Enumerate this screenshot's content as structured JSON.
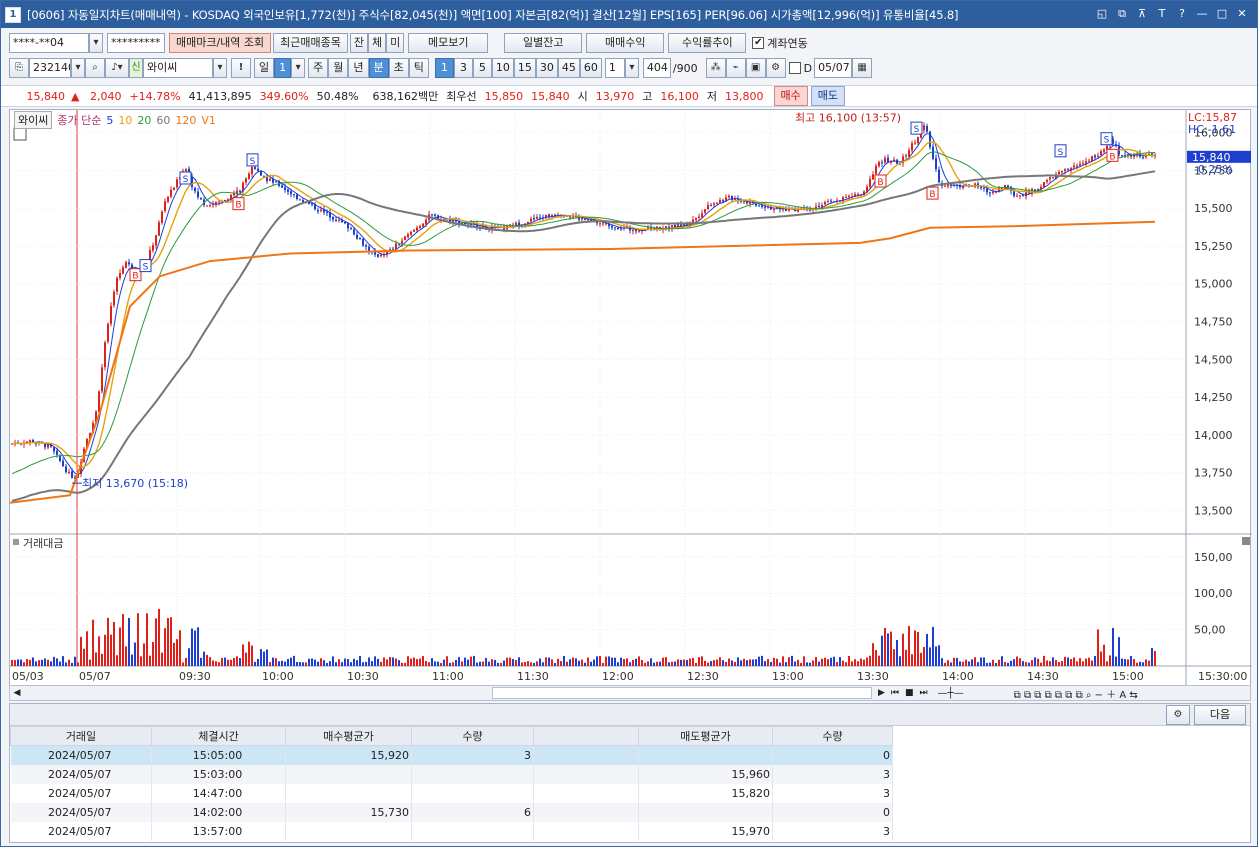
{
  "window": {
    "number": "1",
    "title": "[0606] 자동일지차트(매매내역) - KOSDAQ 외국인보유[1,772(천)] 주식수[82,045(천)] 액면[100] 자본금[82(억)] 결산[12월] EPS[165] PER[96.06] 시가총액[12,996(억)] 유통비율[45.8]",
    "controls": [
      "◱",
      "⧉",
      "⊼",
      "T",
      "?",
      "—",
      "□",
      "✕"
    ]
  },
  "row1": {
    "account": "****-**04",
    "password": "*********",
    "btn_mark": "매매마크/내역 조회",
    "btn_recent": "최근매매종목",
    "btn_jan": "잔",
    "btn_che": "체",
    "btn_mi": "미",
    "btn_memo": "메모보기",
    "btn_daily": "일별잔고",
    "btn_profit": "매매수익",
    "btn_trend": "수익률추이",
    "link_label": "계좌연동",
    "link_checked": "✔"
  },
  "row2": {
    "code": "232140",
    "new_badge": "신",
    "stock_name": "와이씨",
    "warn": "!",
    "periods": [
      "일",
      "1",
      "주",
      "월",
      "년",
      "분",
      "초",
      "틱"
    ],
    "minutes": [
      "1",
      "3",
      "5",
      "10",
      "15",
      "30",
      "45",
      "60"
    ],
    "step": "1",
    "count": "404",
    "count_total": "/900",
    "d_label": "D",
    "date": "05/07",
    "cal_icon": "▦"
  },
  "quote": {
    "price": "15,840",
    "arrow": "▲",
    "change": "2,040",
    "rate": "+14.78%",
    "volume": "41,413,895",
    "vol_ratio": "349.60%",
    "turnover": "50.48%",
    "amount": "638,162백만",
    "best_label": "최우선",
    "ask": "15,850",
    "bid": "15,840",
    "open_label": "시",
    "open": "13,970",
    "high_label": "고",
    "high": "16,100",
    "low_label": "저",
    "low": "13,800",
    "buy": "매수",
    "sell": "매도"
  },
  "chart": {
    "legend": {
      "name": "와이씨",
      "label": "종가 단순",
      "ma": [
        "5",
        "10",
        "20",
        "60",
        "120"
      ],
      "vol": "V1"
    },
    "colors": {
      "up": "#e0201b",
      "down": "#1d3fcf",
      "ma5": "#1d3fcf",
      "ma10": "#e6a20a",
      "ma20": "#2e9a3e",
      "ma60": "#777777",
      "ma120": "#f07516"
    },
    "lc": "LC:15,87",
    "hc": "HC:-1.61",
    "current": "15,840",
    "current_pct": "-0.25%",
    "high_note": "최고 16,100 (13:57)",
    "low_note": "최저 13,670 (15:18)",
    "price_ticks": [
      "16,000",
      "15,750",
      "15,500",
      "15,250",
      "15,000",
      "14,750",
      "14,500",
      "14,250",
      "14,000",
      "13,750",
      "13,500"
    ],
    "volume_title": "거래대금",
    "volume_ticks": [
      "150,00",
      "100,00",
      "50,00"
    ],
    "time_labels": [
      "05/03",
      "05/07",
      "09:30",
      "10:00",
      "10:30",
      "11:00",
      "11:30",
      "12:00",
      "12:30",
      "13:00",
      "13:30",
      "14:00",
      "14:30",
      "15:00",
      "15:30:00"
    ]
  },
  "grid": {
    "next": "다음",
    "gear_icon": "gear-icon",
    "columns": [
      "거래일",
      "체결시간",
      "매수평균가",
      "수량",
      "",
      "매도평균가",
      "수량"
    ],
    "rows": [
      [
        "2024/05/07",
        "15:05:00",
        "15,920",
        "3",
        "",
        "",
        "0"
      ],
      [
        "2024/05/07",
        "15:03:00",
        "",
        "",
        "",
        "15,960",
        "3"
      ],
      [
        "2024/05/07",
        "14:47:00",
        "",
        "",
        "",
        "15,820",
        "3"
      ],
      [
        "2024/05/07",
        "14:02:00",
        "15,730",
        "6",
        "",
        "",
        "0"
      ],
      [
        "2024/05/07",
        "13:57:00",
        "",
        "",
        "",
        "15,970",
        "3"
      ]
    ]
  }
}
